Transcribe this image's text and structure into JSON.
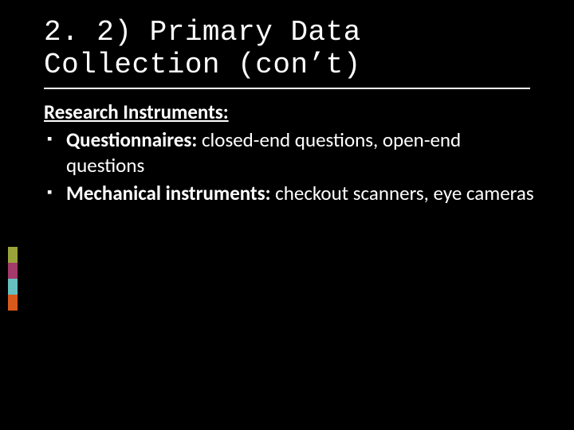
{
  "heading": "2. 2) Primary Data Collection (con’t)",
  "subhead": "Research Instruments:",
  "bullets": [
    {
      "bold": "Questionnaires:",
      "rest": " closed-end questions, open-end questions"
    },
    {
      "bold": "Mechanical instruments:",
      "rest": " checkout scanners, eye cameras"
    }
  ],
  "accent_colors": [
    "#9aa33a",
    "#a23a6a",
    "#66c0c0",
    "#d85a1a"
  ]
}
